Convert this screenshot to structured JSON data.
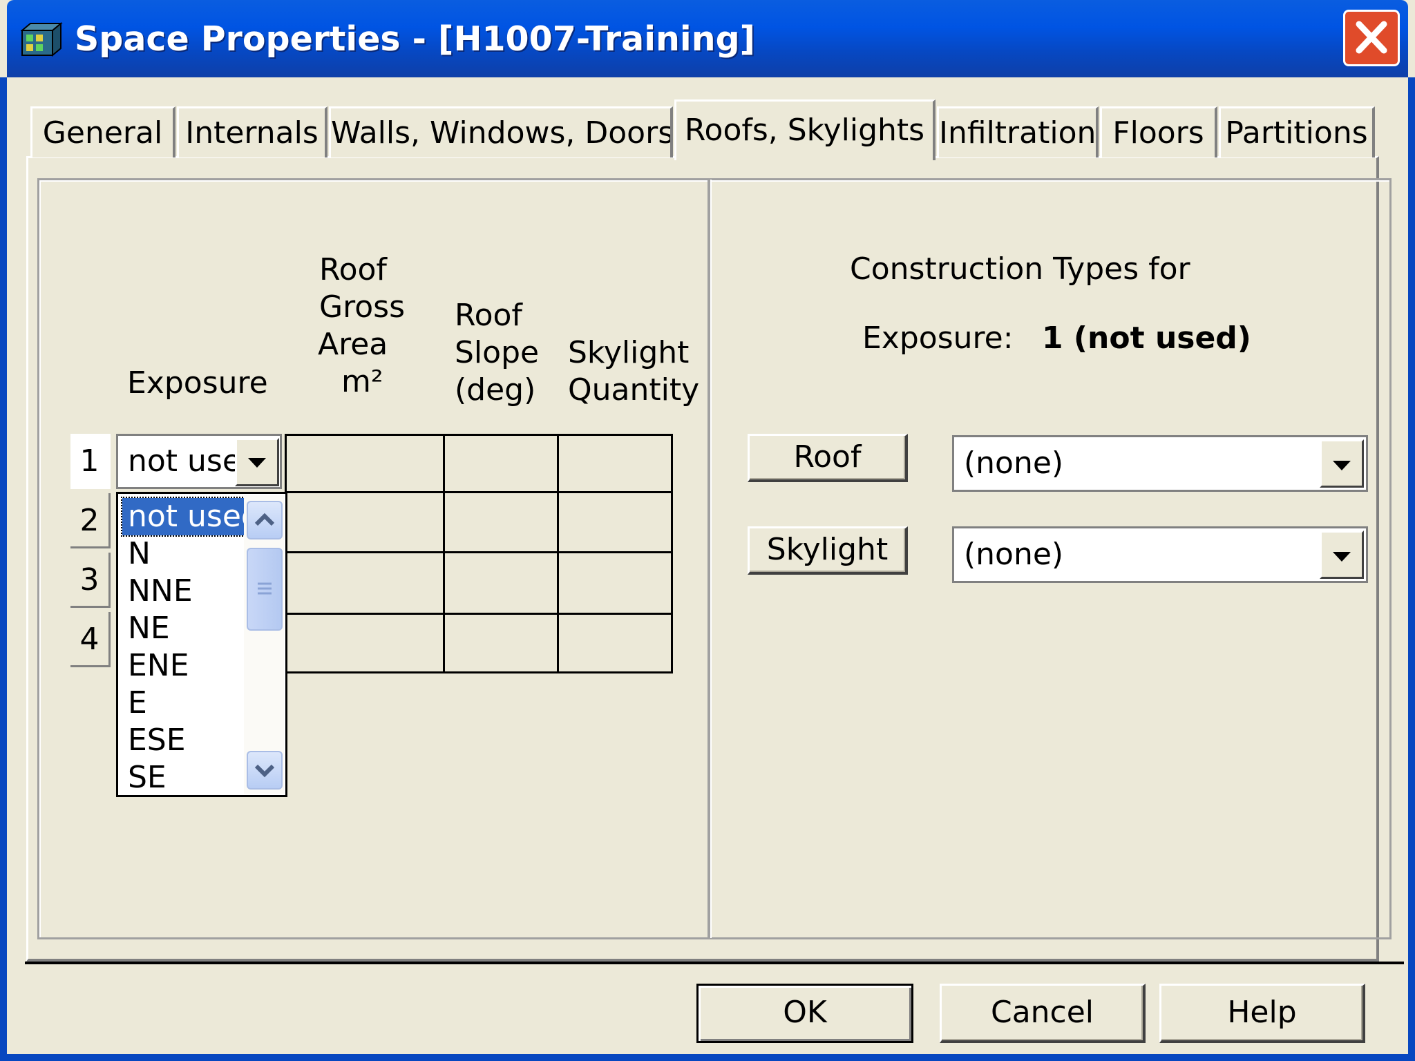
{
  "window": {
    "title": "Space Properties - [H1007-Training]",
    "title_icon": "app-icon",
    "close_icon": "close-icon"
  },
  "tabs": [
    {
      "label": "General",
      "active": false
    },
    {
      "label": "Internals",
      "active": false
    },
    {
      "label": "Walls, Windows, Doors",
      "active": false
    },
    {
      "label": "Roofs, Skylights",
      "active": true
    },
    {
      "label": "Infiltration",
      "active": false
    },
    {
      "label": "Floors",
      "active": false
    },
    {
      "label": "Partitions",
      "active": false
    }
  ],
  "grid": {
    "headers": {
      "exposure": "Exposure",
      "area_1": "Roof",
      "area_2": "Gross",
      "area_3": "Area",
      "area_4": "m²",
      "slope_1": "Roof",
      "slope_2": "Slope",
      "slope_3": "(deg)",
      "qty_1": "Skylight",
      "qty_2": "Quantity"
    },
    "rows": [
      "1",
      "2",
      "3",
      "4"
    ],
    "row1_exposure": "not used"
  },
  "exposure_dropdown": {
    "options": [
      "not used",
      "N",
      "NNE",
      "NE",
      "ENE",
      "E",
      "ESE",
      "SE"
    ],
    "selected": "not used"
  },
  "construction": {
    "heading": "Construction Types for",
    "exposure_label": "Exposure:",
    "exposure_value": "1 (not used)",
    "roof_button": "Roof",
    "roof_value": "(none)",
    "skylight_button": "Skylight",
    "skylight_value": "(none)"
  },
  "footer": {
    "ok": "OK",
    "cancel": "Cancel",
    "help": "Help"
  },
  "colors": {
    "title_bar": "#0054e3",
    "dialog_bg": "#ece9d8",
    "selection": "#316ac5",
    "close_button": "#e04b2a"
  }
}
